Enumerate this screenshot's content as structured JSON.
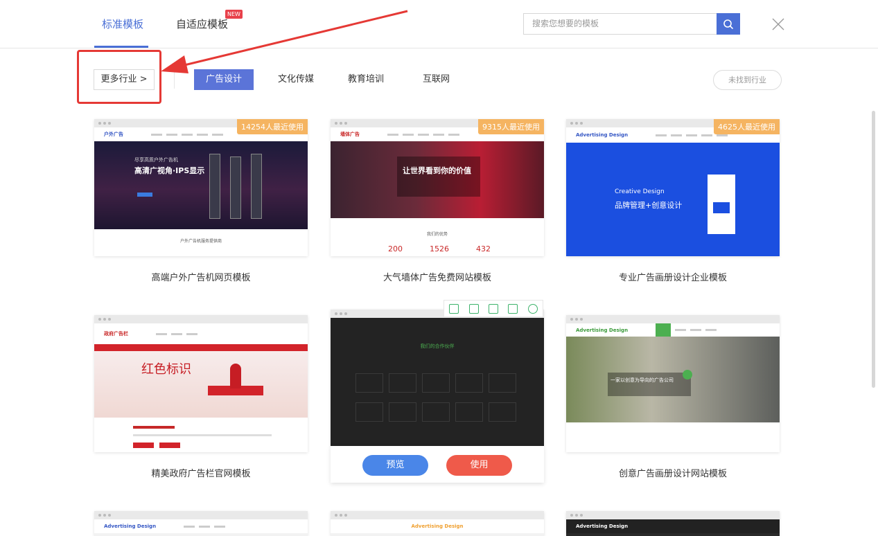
{
  "tabs": [
    {
      "label": "标准模板",
      "active": true
    },
    {
      "label": "自适应模板",
      "active": false
    }
  ],
  "new_badge": "NEW",
  "search": {
    "placeholder": "搜索您想要的模板"
  },
  "filters": {
    "more_industry": "更多行业 >",
    "categories": [
      "广告设计",
      "文化传媒",
      "教育培训",
      "互联网"
    ],
    "not_found": "未找到行业"
  },
  "cards": [
    {
      "title": "高端户外广告机网页模板",
      "usage": "14254人最近使用",
      "logo": "户外广告",
      "hero_line1": "尽享高质户外广告机",
      "hero_line2": "高清广视角·IPS显示",
      "section": "户外广告机服务提供商"
    },
    {
      "title": "大气墙体广告免费网站模板",
      "usage": "9315人最近使用",
      "logo": "墙体广告",
      "hero_line1": "让世界看到你的价值",
      "section": "我们的优势",
      "stats": [
        "200",
        "1526",
        "432"
      ]
    },
    {
      "title": "专业广告画册设计企业模板",
      "usage": "4625人最近使用",
      "logo": "Advertising Design",
      "hero_line1": "Creative Design",
      "hero_line2": "品牌管理+创意设计"
    },
    {
      "title": "精美政府广告栏官网模板",
      "logo": "政府广告栏",
      "hero_line1": "红色标识"
    },
    {
      "title": "",
      "hero_line1": "我们的合作伙伴"
    },
    {
      "title": "创意广告画册设计网站模板",
      "logo": "Advertising Design",
      "hero_line1": "一家以创意为导向的广告公司"
    }
  ],
  "bottom_cards": [
    {
      "logo": "Advertising Design"
    },
    {
      "logo": "Advertising Design"
    },
    {
      "logo": "Advertising Design"
    }
  ],
  "actions": {
    "preview": "预览",
    "use": "使用"
  },
  "colors": {
    "accent": "#4a6fd6",
    "badge": "#f5b461",
    "use": "#ef5a4a",
    "preview": "#4a86e8",
    "highlight": "#e53935"
  }
}
